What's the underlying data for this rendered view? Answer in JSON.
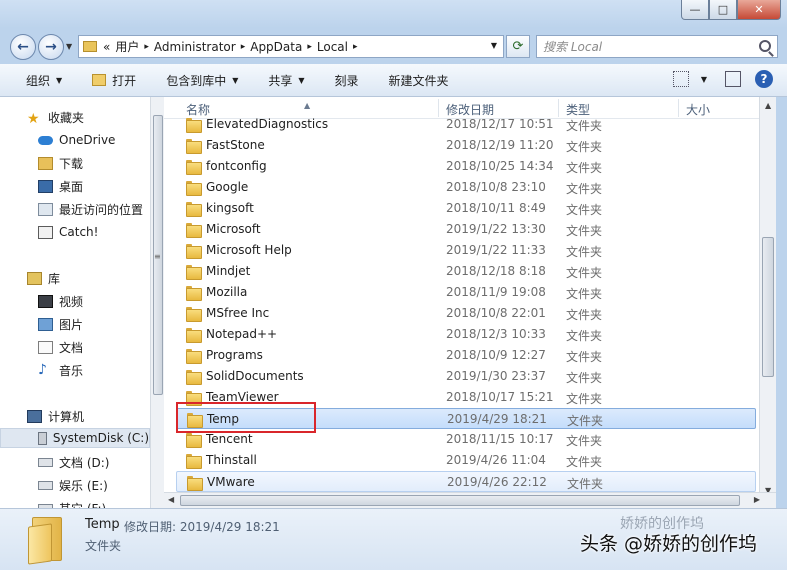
{
  "window": {
    "controls": {
      "minimize": "—",
      "maximize": "□",
      "close": "✕"
    }
  },
  "nav": {
    "back": "←",
    "forward": "→"
  },
  "address": {
    "prefix": "«",
    "crumbs": [
      "用户",
      "Administrator",
      "AppData",
      "Local"
    ],
    "separator": "▸",
    "search_placeholder": "搜索 Local"
  },
  "toolbar": {
    "organize": "组织",
    "open": "打开",
    "include_in_library": "包含到库中",
    "share": "共享",
    "burn": "刻录",
    "new_folder": "新建文件夹"
  },
  "sidebar": {
    "favorites": "收藏夹",
    "fav_items": [
      "OneDrive",
      "下载",
      "桌面",
      "最近访问的位置",
      "Catch!"
    ],
    "libraries": "库",
    "lib_items": [
      "视频",
      "图片",
      "文档",
      "音乐"
    ],
    "computer": "计算机",
    "drives": [
      "SystemDisk (C:)",
      "文档 (D:)",
      "娱乐 (E:)",
      "其它 (F:)"
    ]
  },
  "columns": {
    "name": "名称",
    "modified": "修改日期",
    "type": "类型",
    "size": "大小"
  },
  "files": [
    {
      "name": "ElevatedDiagnostics",
      "date": "2018/12/17 10:51",
      "type": "文件夹"
    },
    {
      "name": "FastStone",
      "date": "2018/12/19 11:20",
      "type": "文件夹"
    },
    {
      "name": "fontconfig",
      "date": "2018/10/25 14:34",
      "type": "文件夹"
    },
    {
      "name": "Google",
      "date": "2018/10/8 23:10",
      "type": "文件夹"
    },
    {
      "name": "kingsoft",
      "date": "2018/10/11 8:49",
      "type": "文件夹"
    },
    {
      "name": "Microsoft",
      "date": "2019/1/22 13:30",
      "type": "文件夹"
    },
    {
      "name": "Microsoft Help",
      "date": "2019/1/22 11:33",
      "type": "文件夹"
    },
    {
      "name": "Mindjet",
      "date": "2018/12/18 8:18",
      "type": "文件夹"
    },
    {
      "name": "Mozilla",
      "date": "2018/11/9 19:08",
      "type": "文件夹"
    },
    {
      "name": "MSfree Inc",
      "date": "2018/10/8 22:01",
      "type": "文件夹"
    },
    {
      "name": "Notepad++",
      "date": "2018/12/3 10:33",
      "type": "文件夹"
    },
    {
      "name": "Programs",
      "date": "2018/10/9 12:27",
      "type": "文件夹"
    },
    {
      "name": "SolidDocuments",
      "date": "2019/1/30 23:37",
      "type": "文件夹"
    },
    {
      "name": "TeamViewer",
      "date": "2018/10/17 15:21",
      "type": "文件夹"
    },
    {
      "name": "Temp",
      "date": "2019/4/29 18:21",
      "type": "文件夹"
    },
    {
      "name": "Tencent",
      "date": "2018/11/15 10:17",
      "type": "文件夹"
    },
    {
      "name": "Thinstall",
      "date": "2019/4/26 11:04",
      "type": "文件夹"
    },
    {
      "name": "VMware",
      "date": "2019/4/26 22:12",
      "type": "文件夹"
    }
  ],
  "selected_index": 14,
  "hover_index": 17,
  "details": {
    "name": "Temp",
    "modified_label": "修改日期:",
    "modified": "2019/4/29 18:21",
    "type": "文件夹"
  },
  "watermark": {
    "main": "头条 @娇娇的创作坞",
    "faint": "娇娇的创作坞"
  },
  "colors": {
    "selection": "#c4ddfb",
    "highlight_box": "#d9262b",
    "window_frame": "#bcd3ec"
  }
}
